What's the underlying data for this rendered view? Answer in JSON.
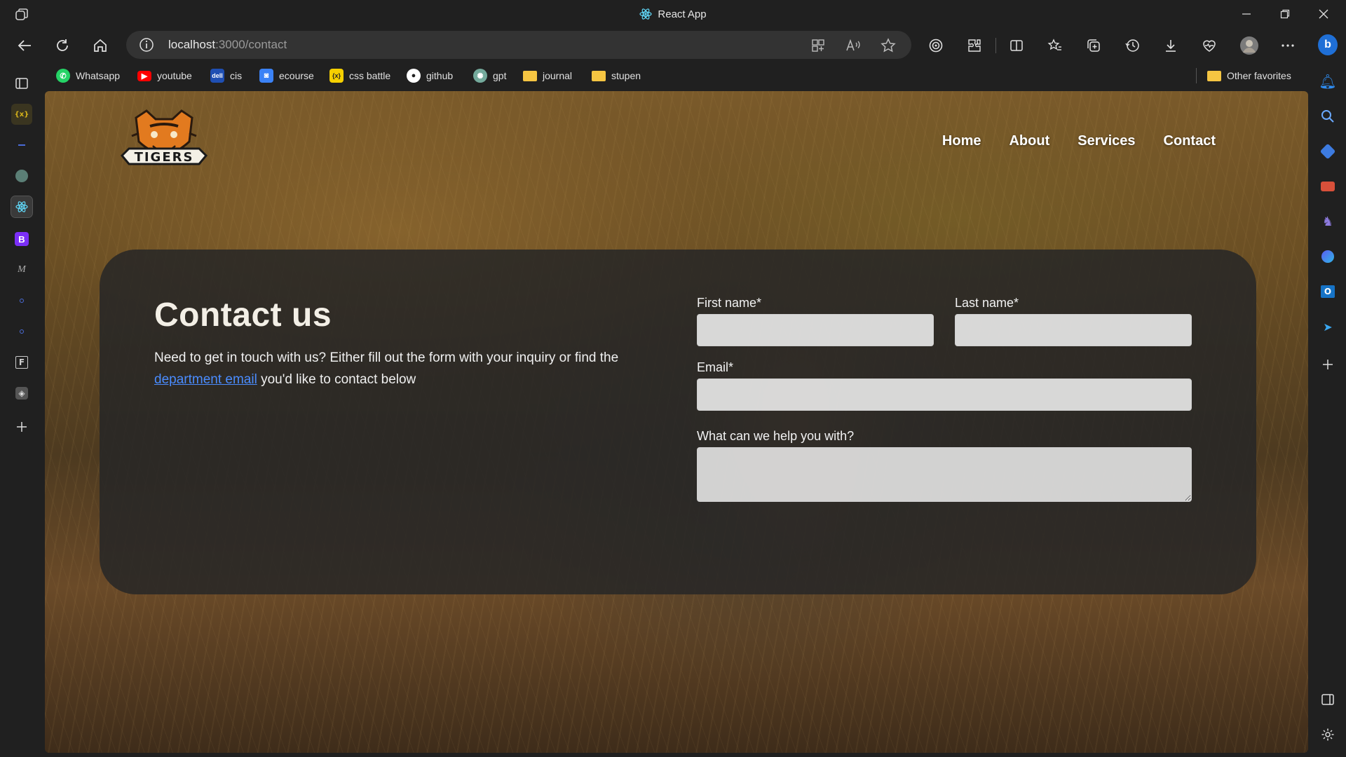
{
  "window": {
    "title": "React App"
  },
  "nav": {
    "url_host": "localhost",
    "url_rest": ":3000/contact"
  },
  "bookmarks": [
    {
      "label": "Whatsapp",
      "icon": "whatsapp-icon",
      "color": "#25d366"
    },
    {
      "label": "youtube",
      "icon": "youtube-icon",
      "color": "#ff0000"
    },
    {
      "label": "cis",
      "icon": "dell-icon",
      "color": "#3b6fd6"
    },
    {
      "label": "ecourse",
      "icon": "ecourse-icon",
      "color": "#3b82f6"
    },
    {
      "label": "css battle",
      "icon": "css-battle-icon",
      "color": "#f5d000"
    },
    {
      "label": "github",
      "icon": "github-icon",
      "color": "#ffffff"
    },
    {
      "label": "gpt",
      "icon": "openai-icon",
      "color": "#74aa9c"
    },
    {
      "label": "journal",
      "icon": "folder-icon",
      "color": "#f5c542"
    },
    {
      "label": "stupen",
      "icon": "folder-icon",
      "color": "#f5c542"
    }
  ],
  "other_favorites": "Other favorites",
  "site": {
    "nav_links": [
      "Home",
      "About",
      "Services",
      "Contact"
    ],
    "logo_text": "TIGERS"
  },
  "contact": {
    "title": "Contact us",
    "desc_before": "Need to get in touch with us? Either fill out the form with your inquiry or find the ",
    "desc_link": "department email",
    "desc_after": " you'd like to contact below",
    "first_name_label": "First name*",
    "last_name_label": "Last name*",
    "email_label": "Email*",
    "help_label": "What can we help you with?"
  },
  "colors": {
    "accent_link": "#4a8cff",
    "card_bg": "#262626"
  }
}
